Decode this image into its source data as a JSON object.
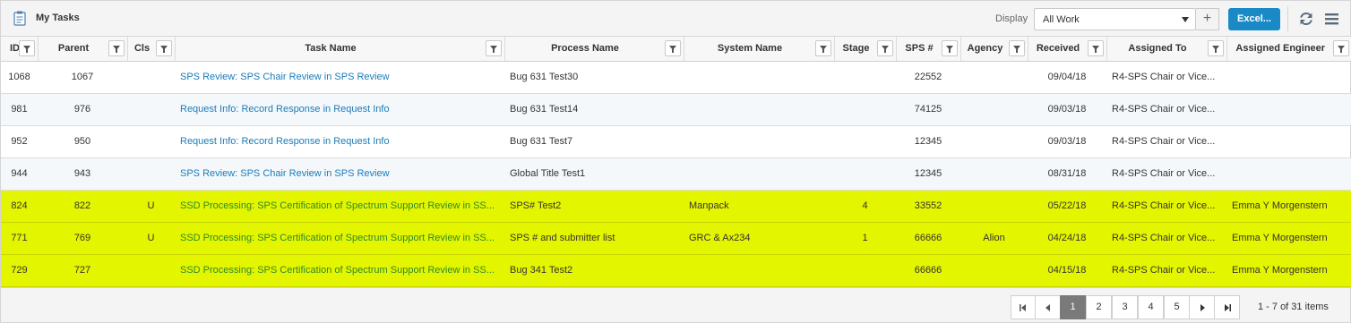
{
  "header": {
    "title": "My Tasks",
    "display_label": "Display",
    "display_value": "All Work",
    "add_label": "+",
    "excel_label": "Excel..."
  },
  "columns": [
    "ID",
    "Parent",
    "Cls",
    "Task Name",
    "Process Name",
    "System Name",
    "Stage",
    "SPS #",
    "Agency",
    "Received",
    "Assigned To",
    "Assigned Engineer"
  ],
  "rows": [
    {
      "id": "1068",
      "parent": "1067",
      "cls": "",
      "task": "SPS Review: SPS Chair Review in SPS Review",
      "process": "Bug 631 Test30",
      "system": "",
      "stage": "",
      "sps": "22552",
      "agency": "",
      "received": "09/04/18",
      "assigned_to": "R4-SPS Chair or Vice...",
      "engineer": ""
    },
    {
      "id": "981",
      "parent": "976",
      "cls": "",
      "task": "Request Info: Record Response in Request Info",
      "process": "Bug 631 Test14",
      "system": "",
      "stage": "",
      "sps": "74125",
      "agency": "",
      "received": "09/03/18",
      "assigned_to": "R4-SPS Chair or Vice...",
      "engineer": ""
    },
    {
      "id": "952",
      "parent": "950",
      "cls": "",
      "task": "Request Info: Record Response in Request Info",
      "process": "Bug 631 Test7",
      "system": "",
      "stage": "",
      "sps": "12345",
      "agency": "",
      "received": "09/03/18",
      "assigned_to": "R4-SPS Chair or Vice...",
      "engineer": ""
    },
    {
      "id": "944",
      "parent": "943",
      "cls": "",
      "task": "SPS Review: SPS Chair Review in SPS Review",
      "process": "Global Title Test1",
      "system": "",
      "stage": "",
      "sps": "12345",
      "agency": "",
      "received": "08/31/18",
      "assigned_to": "R4-SPS Chair or Vice...",
      "engineer": ""
    },
    {
      "id": "824",
      "parent": "822",
      "cls": "U",
      "task": "SSD Processing: SPS Certification of Spectrum Support Review in SS...",
      "process": "SPS# Test2",
      "system": "Manpack",
      "stage": "4",
      "sps": "33552",
      "agency": "",
      "received": "05/22/18",
      "assigned_to": "R4-SPS Chair or Vice...",
      "engineer": "Emma Y Morgenstern"
    },
    {
      "id": "771",
      "parent": "769",
      "cls": "U",
      "task": "SSD Processing: SPS Certification of Spectrum Support Review in SS...",
      "process": "SPS # and submitter list",
      "system": "GRC & Ax234",
      "stage": "1",
      "sps": "66666",
      "agency": "Alion",
      "received": "04/24/18",
      "assigned_to": "R4-SPS Chair or Vice...",
      "engineer": "Emma Y Morgenstern"
    },
    {
      "id": "729",
      "parent": "727",
      "cls": "",
      "task": "SSD Processing: SPS Certification of Spectrum Support Review in SS...",
      "process": "Bug 341 Test2",
      "system": "",
      "stage": "",
      "sps": "66666",
      "agency": "",
      "received": "04/15/18",
      "assigned_to": "R4-SPS Chair or Vice...",
      "engineer": "Emma Y Morgenstern"
    }
  ],
  "pager": {
    "pages": [
      "1",
      "2",
      "3",
      "4",
      "5"
    ],
    "current_page": "1",
    "items_text": "1 - 7 of 31 items"
  },
  "colors": {
    "highlight_row": "#e4f500",
    "task_link": "#1a7cb9",
    "excel_button": "#1a8ac6"
  }
}
